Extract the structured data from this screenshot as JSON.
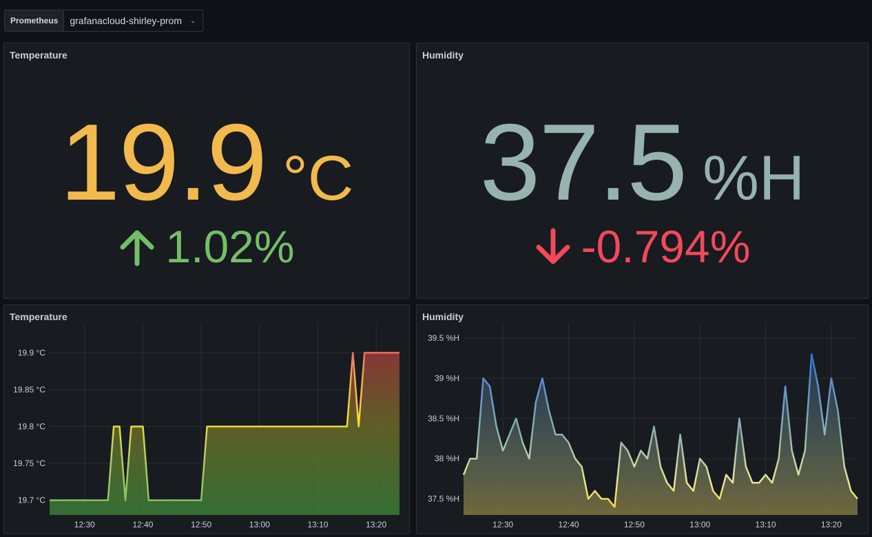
{
  "toolbar": {
    "datasource_label": "Prometheus",
    "datasource_value": "grafanacloud-shirley-prom"
  },
  "stat_panels": {
    "temperature": {
      "title": "Temperature",
      "value": "19.9",
      "unit": "°C",
      "delta": "1.02%",
      "direction": "up",
      "value_color": "#f2b94d",
      "delta_color": "#73bf69"
    },
    "humidity": {
      "title": "Humidity",
      "value": "37.5",
      "unit": "%H",
      "delta": "-0.794%",
      "direction": "down",
      "value_color": "#96b3ae",
      "delta_color": "#f2495c"
    }
  },
  "timeseries_panels": {
    "temperature_title": "Temperature",
    "humidity_title": "Humidity"
  },
  "chart_data": [
    {
      "type": "line",
      "panel": "temperature",
      "title": "Temperature",
      "unit": "°C",
      "x_time_range": [
        "12:24",
        "13:24"
      ],
      "xticks": [
        "12:30",
        "12:40",
        "12:50",
        "13:00",
        "13:10",
        "13:20"
      ],
      "yticks": [
        "19.7 °C",
        "19.75 °C",
        "19.8 °C",
        "19.85 °C",
        "19.9 °C"
      ],
      "ytick_values": [
        19.7,
        19.75,
        19.8,
        19.85,
        19.9
      ],
      "ylim": [
        19.68,
        19.92
      ],
      "grid": true,
      "color_scheme": "green-yellow-red by value",
      "series": [
        {
          "time": [
            "12:24",
            "12:25",
            "12:26",
            "12:27",
            "12:28",
            "12:29",
            "12:30",
            "12:31",
            "12:32",
            "12:33",
            "12:34",
            "12:35",
            "12:36",
            "12:37",
            "12:38",
            "12:39",
            "12:40",
            "12:41",
            "12:42",
            "12:43",
            "12:44",
            "12:45",
            "12:46",
            "12:47",
            "12:48",
            "12:49",
            "12:50",
            "12:51",
            "12:52",
            "12:53",
            "12:54",
            "12:55",
            "12:56",
            "12:57",
            "12:58",
            "12:59",
            "13:00",
            "13:01",
            "13:02",
            "13:03",
            "13:04",
            "13:05",
            "13:06",
            "13:07",
            "13:08",
            "13:09",
            "13:10",
            "13:11",
            "13:12",
            "13:13",
            "13:14",
            "13:15",
            "13:16",
            "13:17",
            "13:18",
            "13:19",
            "13:20",
            "13:21",
            "13:22",
            "13:23",
            "13:24"
          ],
          "values": [
            19.7,
            19.7,
            19.7,
            19.7,
            19.7,
            19.7,
            19.7,
            19.7,
            19.7,
            19.7,
            19.7,
            19.8,
            19.8,
            19.7,
            19.8,
            19.8,
            19.8,
            19.7,
            19.7,
            19.7,
            19.7,
            19.7,
            19.7,
            19.7,
            19.7,
            19.7,
            19.7,
            19.8,
            19.8,
            19.8,
            19.8,
            19.8,
            19.8,
            19.8,
            19.8,
            19.8,
            19.8,
            19.8,
            19.8,
            19.8,
            19.8,
            19.8,
            19.8,
            19.8,
            19.8,
            19.8,
            19.8,
            19.8,
            19.8,
            19.8,
            19.8,
            19.8,
            19.9,
            19.8,
            19.9,
            19.9,
            19.9,
            19.9,
            19.9,
            19.9,
            19.9
          ]
        }
      ]
    },
    {
      "type": "area",
      "panel": "humidity",
      "title": "Humidity",
      "unit": "%H",
      "x_time_range": [
        "12:24",
        "13:24"
      ],
      "xticks": [
        "12:30",
        "12:40",
        "12:50",
        "13:00",
        "13:10",
        "13:20"
      ],
      "yticks": [
        "37.5 %H",
        "38 %H",
        "38.5 %H",
        "39 %H",
        "39.5 %H"
      ],
      "ytick_values": [
        37.5,
        38,
        38.5,
        39,
        39.5
      ],
      "ylim": [
        37.3,
        39.5
      ],
      "grid": true,
      "color_scheme": "yellow-to-blue by value",
      "series": [
        {
          "time": [
            "12:24",
            "12:25",
            "12:26",
            "12:27",
            "12:28",
            "12:29",
            "12:30",
            "12:31",
            "12:32",
            "12:33",
            "12:34",
            "12:35",
            "12:36",
            "12:37",
            "12:38",
            "12:39",
            "12:40",
            "12:41",
            "12:42",
            "12:43",
            "12:44",
            "12:45",
            "12:46",
            "12:47",
            "12:48",
            "12:49",
            "12:50",
            "12:51",
            "12:52",
            "12:53",
            "12:54",
            "12:55",
            "12:56",
            "12:57",
            "12:58",
            "12:59",
            "13:00",
            "13:01",
            "13:02",
            "13:03",
            "13:04",
            "13:05",
            "13:06",
            "13:07",
            "13:08",
            "13:09",
            "13:10",
            "13:11",
            "13:12",
            "13:13",
            "13:14",
            "13:15",
            "13:16",
            "13:17",
            "13:18",
            "13:19",
            "13:20",
            "13:21",
            "13:22",
            "13:23",
            "13:24"
          ],
          "values": [
            37.8,
            38.0,
            38.0,
            39.0,
            38.9,
            38.4,
            38.1,
            38.3,
            38.5,
            38.2,
            38.0,
            38.7,
            39.0,
            38.6,
            38.3,
            38.3,
            38.2,
            38.0,
            37.9,
            37.5,
            37.6,
            37.5,
            37.5,
            37.4,
            38.2,
            38.1,
            37.9,
            38.1,
            38.0,
            38.4,
            37.9,
            37.7,
            37.6,
            38.3,
            37.7,
            37.6,
            38.0,
            37.9,
            37.6,
            37.5,
            37.8,
            37.7,
            38.5,
            37.9,
            37.7,
            37.7,
            37.8,
            37.7,
            38.0,
            38.9,
            38.1,
            37.8,
            38.1,
            39.3,
            38.9,
            38.3,
            39.0,
            38.6,
            37.9,
            37.6,
            37.5
          ]
        }
      ]
    }
  ]
}
